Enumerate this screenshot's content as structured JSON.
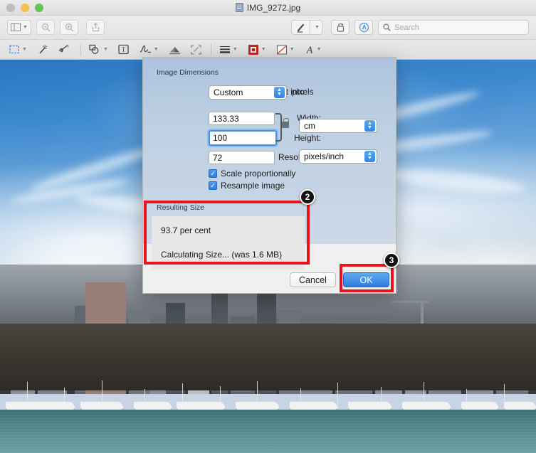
{
  "window": {
    "title": "IMG_9272.jpg",
    "traffic_lights": [
      "close",
      "minimize",
      "zoom"
    ]
  },
  "toolbar": {
    "sidebar_label": "sidebar-toggle",
    "zoom_out_label": "zoom-out",
    "zoom_in_label": "zoom-in",
    "share_label": "share",
    "markup_label": "markup",
    "rotate_label": "rotate",
    "annotate_label": "annotate",
    "search": {
      "placeholder": "Search",
      "value": ""
    }
  },
  "markup_toolbar": {
    "items": [
      {
        "name": "selection-tool",
        "icon": "rect-select",
        "has_caret": true
      },
      {
        "name": "instant-alpha-tool",
        "icon": "magic-wand",
        "has_caret": false
      },
      {
        "name": "sketch-tool",
        "icon": "sketch-pen",
        "has_caret": false
      },
      {
        "name": "shapes-tool",
        "icon": "shapes",
        "has_caret": true
      },
      {
        "name": "text-tool",
        "icon": "text-box",
        "has_caret": false
      },
      {
        "name": "sign-tool",
        "icon": "signature",
        "has_caret": true
      },
      {
        "name": "adjust-color-tool",
        "icon": "adjust-color",
        "has_caret": false
      },
      {
        "name": "adjust-size-tool",
        "icon": "adjust-size",
        "has_caret": false
      },
      {
        "name": "shape-style-tool",
        "icon": "lines",
        "has_caret": true
      },
      {
        "name": "border-color-tool",
        "icon": "border-color-swatch",
        "has_caret": true
      },
      {
        "name": "fill-color-tool",
        "icon": "fill-color-swatch",
        "has_caret": true
      },
      {
        "name": "text-style-tool",
        "icon": "font-A",
        "has_caret": true
      }
    ],
    "colors": {
      "border_swatch": "#c0261f",
      "fill_swatch": "#e23b34"
    }
  },
  "dialog": {
    "section_title": "Image Dimensions",
    "fit_into": {
      "label": "Fit into:",
      "value": "Custom",
      "unit": "pixels"
    },
    "width": {
      "label": "Width:",
      "value": "133.33"
    },
    "height": {
      "label": "Height:",
      "value": "100"
    },
    "size_unit": {
      "value": "cm"
    },
    "resolution": {
      "label": "Resolution:",
      "value": "72"
    },
    "resolution_unit": {
      "value": "pixels/inch"
    },
    "checkboxes": [
      {
        "label": "Scale proportionally",
        "checked": true
      },
      {
        "label": "Resample image",
        "checked": true
      }
    ],
    "resulting_size": {
      "title": "Resulting Size",
      "percent": "93.7 per cent",
      "status": "Calculating Size... (was 1.6 MB)"
    },
    "buttons": {
      "cancel": "Cancel",
      "ok": "OK"
    }
  },
  "annotations": {
    "color": "#e8141c",
    "badges": [
      {
        "number": "2",
        "target": "resulting-size-box"
      },
      {
        "number": "3",
        "target": "ok-button"
      }
    ]
  },
  "image": {
    "subject": "harbour-city-skyline-with-marina"
  }
}
